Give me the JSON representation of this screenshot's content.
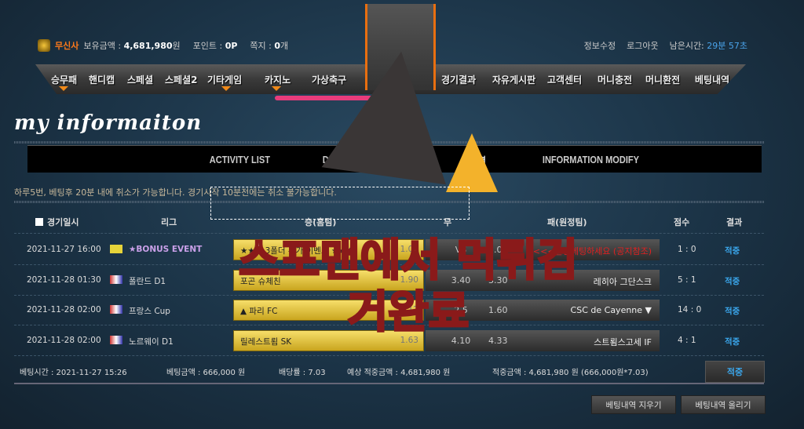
{
  "user": {
    "nickname": "무신사",
    "balance_label": "보유금액 : ",
    "balance": "4,681,980",
    "balance_unit": "원",
    "point_label": "포인트 : ",
    "point": "0P",
    "memo_label": "쪽지 : ",
    "memo": "0",
    "memo_unit": "개"
  },
  "top_links": {
    "edit": "정보수정",
    "logout": "로그아웃",
    "remaining_label": "남은시간:",
    "remaining": "29분 57초"
  },
  "nav": [
    "승무패",
    "핸디캡",
    "스페셜",
    "스페셜2",
    "기타게임",
    "카지노",
    "가상축구",
    "경기결과",
    "자유게시판",
    "고객센터",
    "머니충전",
    "머니환전",
    "베팅내역"
  ],
  "page_title": "my informaiton",
  "tabs": [
    "ACTIVITY LIST",
    "D",
    "내역",
    "INFORMATION MODIFY"
  ],
  "notice": "하루5번, 베팅후 20분 내에 취소가 가능합니다. 경기시작 10분전에는 취소 불가능합니다.",
  "table": {
    "headers": [
      "경기일시",
      "리그",
      "승(홈팀)",
      "무",
      "패(원정팀)",
      "점수",
      "결과"
    ],
    "rows": [
      {
        "date": "2021-11-27 16:00",
        "league": "★BONUS EVENT",
        "home": "★★★ 3폴더 추가 이벤트 ★★★",
        "home_odds": "1.04",
        "draw": "VS",
        "away_odds": "1.00",
        "away": "<<<<올림베팅하세요 (공지참조)",
        "score": "1 : 0",
        "result": "적중"
      },
      {
        "date": "2021-11-28 01:30",
        "league": "폴란드 D1",
        "home": "포곤 슈체친",
        "home_odds": "1.90",
        "draw": "3.40",
        "away_odds": "3.30",
        "away": "레히아 그단스크",
        "score": "5 : 1",
        "result": "적중"
      },
      {
        "date": "2021-11-28 02:00",
        "league": "프랑스 Cup",
        "home": "▲ 파리 FC",
        "home_odds": "2.12",
        "draw": "2.5",
        "away_odds": "1.60",
        "away": "CSC de Cayenne ▼",
        "score": "14 : 0",
        "result": "적중"
      },
      {
        "date": "2021-11-28 02:00",
        "league": "노르웨이 D1",
        "home": "릴레스트룀 SK",
        "home_odds": "1.63",
        "draw": "4.10",
        "away_odds": "4.33",
        "away": "스트룀스고세 IF",
        "score": "4 : 1",
        "result": "적중"
      }
    ]
  },
  "summary": {
    "bet_time": "베팅시간 : 2021-11-27 15:26",
    "bet_amount": "베팅금액 : 666,000 원",
    "odds": "배당률 : 7.03",
    "expected": "예상 적중금액 : 4,681,980 원",
    "won": "적중금액 : 4,681,980 원 (666,000원*7.03)",
    "result": "적중"
  },
  "buttons": {
    "delete": "베팅내역 지우기",
    "post": "베팅내역 올리기"
  },
  "watermark": "스포맨에서 먹튀검거완료",
  "colors": {
    "accent": "#f08a1a",
    "result": "#3aa5ea",
    "gold": "#e3c440"
  }
}
